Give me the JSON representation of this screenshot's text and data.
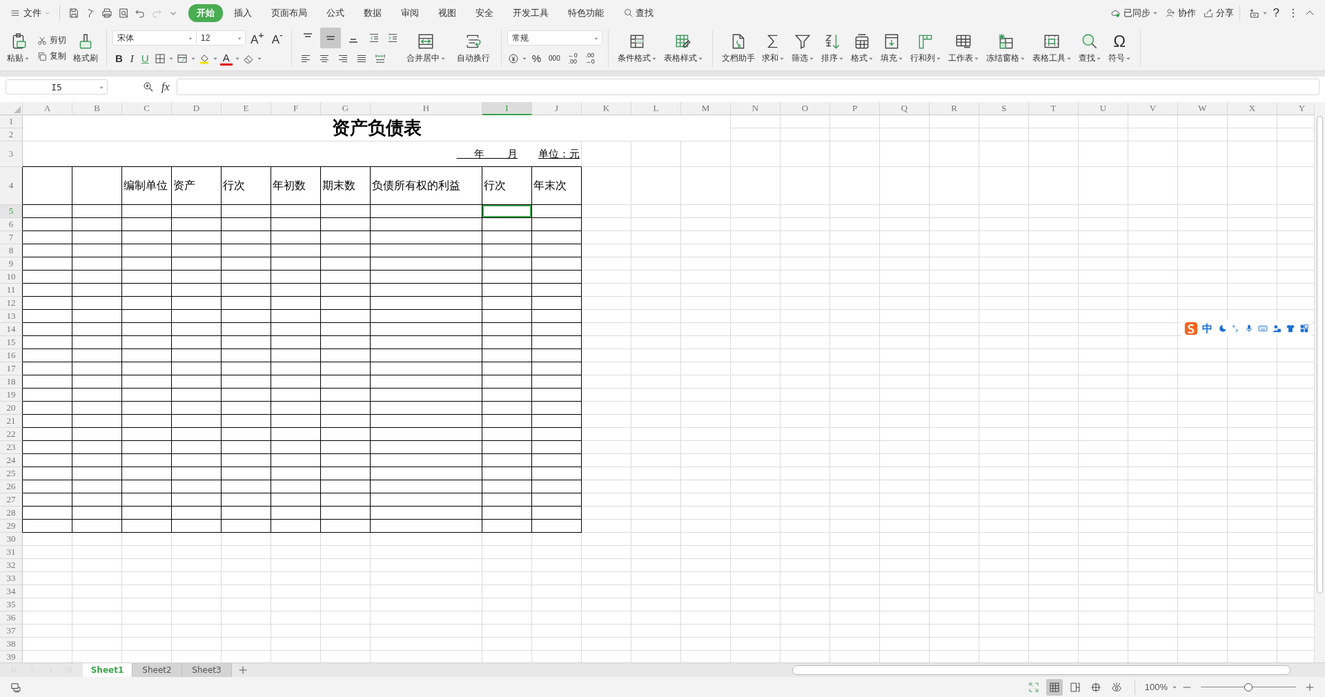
{
  "topbar": {
    "file_menu": "文件",
    "tabs": [
      {
        "label": "开始",
        "selected": true
      },
      {
        "label": "插入",
        "selected": false
      },
      {
        "label": "页面布局",
        "selected": false
      },
      {
        "label": "公式",
        "selected": false
      },
      {
        "label": "数据",
        "selected": false
      },
      {
        "label": "审阅",
        "selected": false
      },
      {
        "label": "视图",
        "selected": false
      },
      {
        "label": "安全",
        "selected": false
      },
      {
        "label": "开发工具",
        "selected": false
      },
      {
        "label": "特色功能",
        "selected": false
      }
    ],
    "search": "查找",
    "actions": [
      {
        "label": "已同步",
        "dropdown": true
      },
      {
        "label": "协作",
        "dropdown": false
      },
      {
        "label": "分享",
        "dropdown": false
      }
    ],
    "help": "?"
  },
  "ribbon": {
    "paste": {
      "label": "粘贴",
      "dropdown": true
    },
    "cut": "剪切",
    "copy": "复制",
    "format_painter": "格式刷",
    "font": {
      "name": "宋体",
      "size": "12"
    },
    "font_size_buttons": [
      "A$^{+}$",
      "A$^{-}$"
    ],
    "style_buttons": [
      "B",
      "I",
      "U"
    ],
    "font_color": "A",
    "vertical_align": [
      {
        "selected": false
      },
      {
        "selected": true
      },
      {
        "selected": false
      }
    ],
    "alignment": [
      {
        "label": "合并居中",
        "dropdown": true
      },
      {
        "label": "自动换行",
        "dropdown": false
      }
    ],
    "number_format": "常规",
    "number_buttons": [
      "%",
      "000"
    ],
    "decimal_buttons": [
      {
        "top": "←0",
        "bottom": ".00"
      },
      {
        "top": ".00",
        "bottom": "→0"
      }
    ],
    "tools": [
      {
        "label": "条件格式",
        "dropdown": true
      },
      {
        "label": "表格样式",
        "dropdown": true
      },
      {
        "label": "文档助手",
        "dropdown": false
      },
      {
        "label": "求和",
        "dropdown": true
      },
      {
        "label": "筛选",
        "dropdown": true
      },
      {
        "label": "排序",
        "dropdown": true
      },
      {
        "label": "格式",
        "dropdown": true
      },
      {
        "label": "填充",
        "dropdown": true
      },
      {
        "label": "行和列",
        "dropdown": true
      },
      {
        "label": "工作表",
        "dropdown": true
      },
      {
        "label": "冻结窗格",
        "dropdown": true
      },
      {
        "label": "表格工具",
        "dropdown": true
      },
      {
        "label": "查找",
        "dropdown": true
      },
      {
        "label": "符号",
        "dropdown": true,
        "glyph": "Ω"
      }
    ]
  },
  "formula_bar": {
    "name_box": "I5",
    "fx": "fx"
  },
  "sheet": {
    "columns": [
      {
        "label": "A",
        "selected": false
      },
      {
        "label": "B",
        "selected": false
      },
      {
        "label": "C",
        "selected": false
      },
      {
        "label": "D",
        "selected": false
      },
      {
        "label": "E",
        "selected": false
      },
      {
        "label": "F",
        "selected": false
      },
      {
        "label": "G",
        "selected": false
      },
      {
        "label": "H",
        "selected": false
      },
      {
        "label": "I",
        "selected": true
      },
      {
        "label": "J",
        "selected": false
      },
      {
        "label": "K",
        "selected": false
      },
      {
        "label": "L",
        "selected": false
      },
      {
        "label": "M",
        "selected": false
      },
      {
        "label": "N",
        "selected": false
      },
      {
        "label": "O",
        "selected": false
      },
      {
        "label": "P",
        "selected": false
      },
      {
        "label": "Q",
        "selected": false
      },
      {
        "label": "R",
        "selected": false
      },
      {
        "label": "S",
        "selected": false
      },
      {
        "label": "T",
        "selected": false
      },
      {
        "label": "U",
        "selected": false
      },
      {
        "label": "V",
        "selected": false
      },
      {
        "label": "W",
        "selected": false
      },
      {
        "label": "X",
        "selected": false
      },
      {
        "label": "Y",
        "selected": false
      }
    ],
    "rows": [
      {
        "label": "1",
        "selected": false
      },
      {
        "label": "2",
        "selected": false
      },
      {
        "label": "3",
        "selected": false
      },
      {
        "label": "4",
        "selected": false
      },
      {
        "label": "5",
        "selected": true
      },
      {
        "label": "6",
        "selected": false
      },
      {
        "label": "7",
        "selected": false
      },
      {
        "label": "8",
        "selected": false
      },
      {
        "label": "9",
        "selected": false
      },
      {
        "label": "10",
        "selected": false
      },
      {
        "label": "11",
        "selected": false
      },
      {
        "label": "12",
        "selected": false
      },
      {
        "label": "13",
        "selected": false
      },
      {
        "label": "14",
        "selected": false
      },
      {
        "label": "15",
        "selected": false
      },
      {
        "label": "16",
        "selected": false
      },
      {
        "label": "17",
        "selected": false
      },
      {
        "label": "18",
        "selected": false
      },
      {
        "label": "19",
        "selected": false
      },
      {
        "label": "20",
        "selected": false
      },
      {
        "label": "21",
        "selected": false
      },
      {
        "label": "22",
        "selected": false
      },
      {
        "label": "23",
        "selected": false
      },
      {
        "label": "24",
        "selected": false
      },
      {
        "label": "25",
        "selected": false
      },
      {
        "label": "26",
        "selected": false
      },
      {
        "label": "27",
        "selected": false
      },
      {
        "label": "28",
        "selected": false
      },
      {
        "label": "29",
        "selected": false
      },
      {
        "label": "30",
        "selected": false
      },
      {
        "label": "31",
        "selected": false
      },
      {
        "label": "32",
        "selected": false
      },
      {
        "label": "33",
        "selected": false
      },
      {
        "label": "34",
        "selected": false
      },
      {
        "label": "35",
        "selected": false
      },
      {
        "label": "36",
        "selected": false
      },
      {
        "label": "37",
        "selected": false
      },
      {
        "label": "38",
        "selected": false
      },
      {
        "label": "39",
        "selected": false
      }
    ],
    "title": "资产负债表",
    "subtitle": [
      "      年        月",
      "单位：元"
    ],
    "header_row": [
      "编制单位",
      "资产",
      "行次",
      "年初数",
      "期末数",
      "负债所有权的利益",
      "行次",
      "年末次"
    ]
  },
  "sheet_tabs": [
    {
      "label": "Sheet1",
      "selected": true
    },
    {
      "label": "Sheet2",
      "selected": false
    },
    {
      "label": "Sheet3",
      "selected": false
    }
  ],
  "status_bar": {
    "view_buttons": [
      {
        "selected": false
      },
      {
        "selected": true
      },
      {
        "selected": false
      },
      {
        "selected": false
      },
      {
        "selected": false
      }
    ],
    "zoom": "100%",
    "level": 0.5
  },
  "ime": {
    "mode": "中"
  }
}
